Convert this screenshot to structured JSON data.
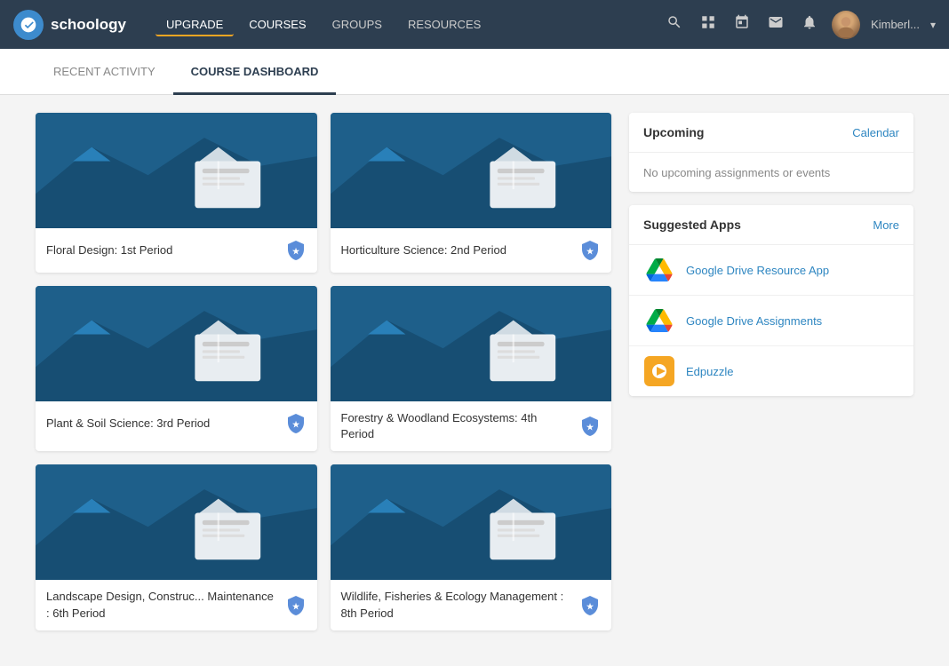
{
  "navbar": {
    "logo_letter": "S",
    "logo_text": "schoology",
    "upgrade_label": "UPGRADE",
    "courses_label": "COURSES",
    "groups_label": "GROUPS",
    "resources_label": "RESOURCES",
    "username": "Kimberl...",
    "icons": {
      "search": "🔍",
      "apps": "⊞",
      "calendar": "📅",
      "mail": "✉",
      "bell": "🔔"
    }
  },
  "tabs": [
    {
      "label": "RECENT ACTIVITY",
      "active": false
    },
    {
      "label": "COURSE DASHBOARD",
      "active": true
    }
  ],
  "courses": [
    {
      "name": "Floral Design: 1st Period",
      "id": "course-1"
    },
    {
      "name": "Horticulture Science: 2nd Period",
      "id": "course-2"
    },
    {
      "name": "Plant & Soil Science: 3rd Period",
      "id": "course-3"
    },
    {
      "name": "Forestry & Woodland Ecosystems: 4th Period",
      "id": "course-4"
    },
    {
      "name": "Landscape Design, Construc... Maintenance : 6th Period",
      "id": "course-5"
    },
    {
      "name": "Wildlife, Fisheries & Ecology Management : 8th Period",
      "id": "course-6"
    }
  ],
  "sidebar": {
    "upcoming": {
      "title": "Upcoming",
      "calendar_link": "Calendar",
      "empty_text": "No upcoming assignments or events"
    },
    "suggested_apps": {
      "title": "Suggested Apps",
      "more_link": "More",
      "apps": [
        {
          "name": "Google Drive Resource App",
          "type": "gdrive"
        },
        {
          "name": "Google Drive Assignments",
          "type": "gdrive"
        },
        {
          "name": "Edpuzzle",
          "type": "edpuzzle"
        }
      ]
    }
  },
  "accessibility": {
    "icon_label": "♿"
  }
}
